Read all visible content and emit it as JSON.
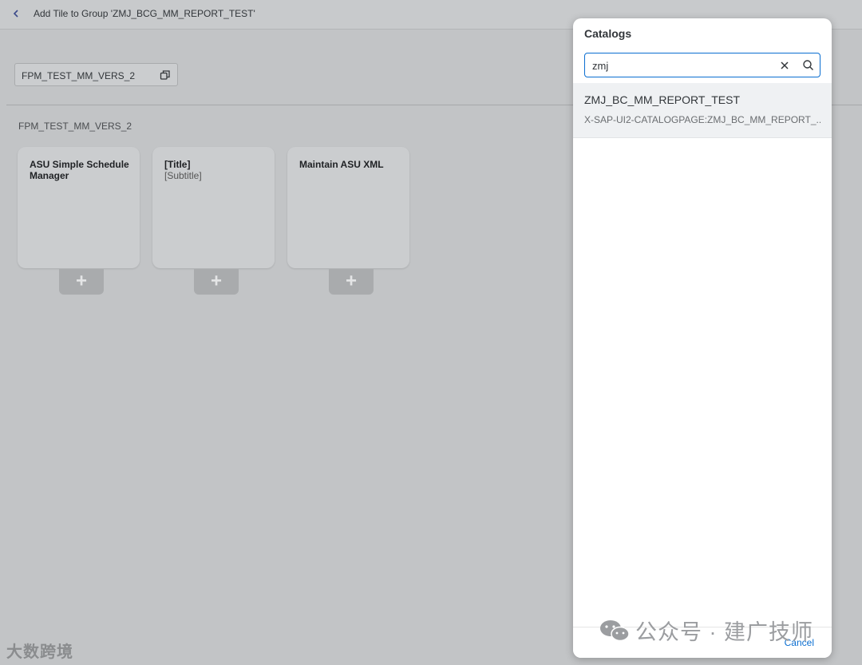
{
  "header": {
    "title": "Add Tile to Group 'ZMJ_BCG_MM_REPORT_TEST'"
  },
  "catalog_selector": {
    "value": "FPM_TEST_MM_VERS_2"
  },
  "section": {
    "title": "FPM_TEST_MM_VERS_2"
  },
  "tiles": [
    {
      "title": "ASU Simple Schedule Manager",
      "subtitle": ""
    },
    {
      "title": "[Title]",
      "subtitle": "[Subtitle]"
    },
    {
      "title": "Maintain ASU XML",
      "subtitle": ""
    }
  ],
  "add_button_symbol": "+",
  "dialog": {
    "title": "Catalogs",
    "search": {
      "value": "zmj"
    },
    "results": [
      {
        "title": "ZMJ_BC_MM_REPORT_TEST",
        "description": "X-SAP-UI2-CATALOGPAGE:ZMJ_BC_MM_REPORT_..."
      }
    ],
    "cancel_label": "Cancel"
  },
  "watermarks": {
    "left": "大数跨境",
    "right": "公众号 · 建广技师"
  },
  "colors": {
    "accent": "#0a6ed1",
    "overlay": "#c2c4c6"
  }
}
